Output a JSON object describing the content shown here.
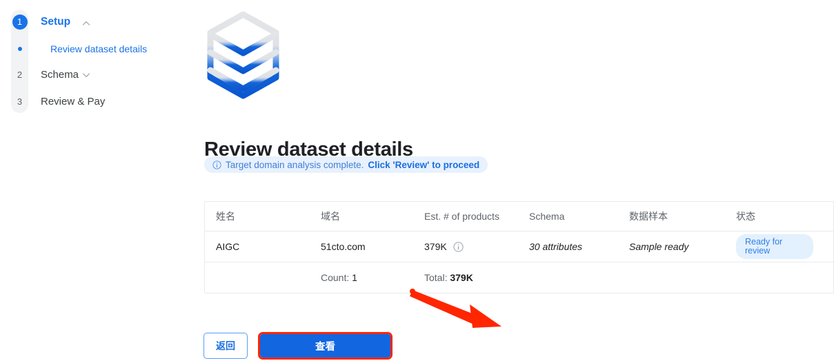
{
  "stepper": {
    "steps": [
      {
        "number": "1",
        "label": "Setup",
        "chevron": "chevron-up-icon",
        "active": true
      },
      {
        "number": "2",
        "label": "Schema",
        "chevron": "chevron-down-icon",
        "active": false
      },
      {
        "number": "3",
        "label": "Review & Pay",
        "chevron": "",
        "active": false
      }
    ],
    "substep": {
      "label": "Review dataset details",
      "marker": "bullet-dot"
    }
  },
  "brand": {
    "logo_icon": "stacked-layers-hexagon-logo",
    "gradient_top": "#dadce0",
    "gradient_bottom": "#0b57d0"
  },
  "main": {
    "title": "Review dataset details",
    "banner": {
      "icon": "info-circle-icon",
      "text": "Target domain analysis complete.",
      "bold_text": "Click 'Review' to proceed",
      "bg_color": "#e8f1fe",
      "text_color": "#3f7fd8"
    },
    "table": {
      "headers": [
        "姓名",
        "域名",
        "Est. # of products",
        "Schema",
        "数据样本",
        "状态"
      ],
      "rows": [
        {
          "name": "AIGC",
          "domain": "51cto.com",
          "products": "379K",
          "products_icon": "info-circle-icon",
          "schema": "30 attributes",
          "sample": "Sample ready",
          "status": "Ready for review",
          "status_bg": "#e3f0fd",
          "status_color": "#2e7fe8"
        }
      ],
      "footer": {
        "count_label": "Count:",
        "count_value": "1",
        "total_label": "Total:",
        "total_value": "379K"
      }
    },
    "buttons": {
      "back_label": "返回",
      "primary_label": "查看",
      "primary_bg": "#1266e0",
      "highlight_color": "#ff2600"
    },
    "annotation": {
      "arrow_icon": "red-arrow-pointing-to-primary-button",
      "color": "#ff2600"
    }
  }
}
